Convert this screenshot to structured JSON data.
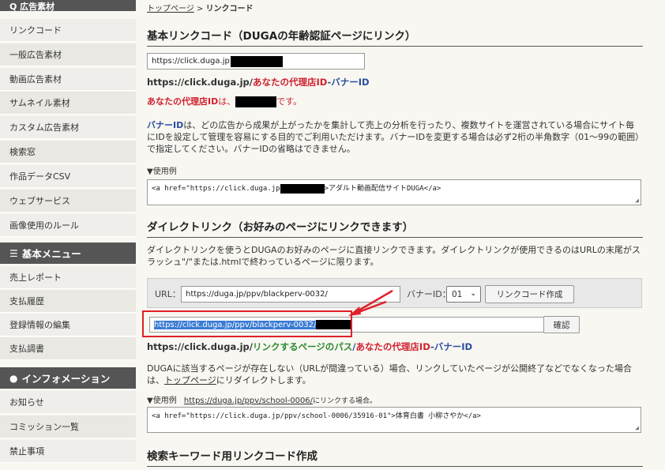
{
  "sidebar": {
    "top_heading": "Q 広告素材",
    "ad_items": [
      "リンクコード",
      "一般広告素材",
      "動画広告素材",
      "サムネイル素材",
      "カスタム広告素材",
      "検索窓",
      "作品データCSV",
      "ウェブサービス",
      "画像使用のルール"
    ],
    "basic_menu_heading": "基本メニュー",
    "basic_items": [
      "売上レポート",
      "支払履歴",
      "登録情報の編集",
      "支払調書"
    ],
    "info_heading": "インフォメーション",
    "info_items": [
      "お知らせ",
      "コミッション一覧",
      "禁止事項"
    ]
  },
  "breadcrumb": {
    "home": "トップページ",
    "sep": " > ",
    "current": "リンクコード"
  },
  "basic": {
    "heading": "基本リンクコード（DUGAの年齢認証ページにリンク）",
    "input_value": "https://click.duga.jp",
    "format_prefix": "https://click.duga.jp/",
    "format_agent": "あなたの代理店ID",
    "format_dash": "-",
    "format_banner": "バナーID",
    "agent_label": "あなたの代理店ID",
    "agent_mid": "は、",
    "agent_suffix": "です。",
    "banner_term": "バナーID",
    "banner_desc": "は、どの広告から成果が上がったかを集計して売上の分析を行ったり、複数サイトを運営されている場合にサイト毎にIDを設定して管理を容易にする目的でご利用いただけます。バナーIDを変更する場合は必ず2桁の半角数字（01〜99の範囲）で指定してください。バナーIDの省略はできません。",
    "example_label": "▼使用例",
    "example_code_a": "<a href=\"https://click.duga.jp",
    "example_code_b": ">アダルト動画配信サイトDUGA</a>"
  },
  "direct": {
    "heading": "ダイレクトリンク（お好みのページにリンクできます）",
    "desc": "ダイレクトリンクを使うとDUGAのお好みのページに直接リンクできます。ダイレクトリンクが使用できるのはURLの末尾がスラッシュ\"/\"または.htmlで終わっているページに限ります。",
    "url_label": "URL：",
    "url_value": "https://duga.jp/ppv/blackperv-0032/",
    "banner_label": "バナーID：",
    "banner_value": "01",
    "create_button": "リンクコード作成",
    "result_value": "https://click.duga.jp/ppv/blackperv-0032/",
    "confirm_button": "確認",
    "format_prefix": "https://click.duga.jp/",
    "format_path": "リンクするページのパス",
    "format_slash": "/",
    "format_agent": "あなたの代理店ID",
    "format_dash": "-",
    "format_banner": "バナーID",
    "note_a": "DUGAに該当するページが存在しない（URLが間違っている）場合、リンクしていたページが公開終了などでなくなった場合は、",
    "note_link": "トップページ",
    "note_b": "にリダイレクトします。",
    "example_label": "▼使用例",
    "example_url": "https://duga.jp/ppv/school-0006/",
    "example_suffix": "にリンクする場合。",
    "example_code": "<a href=\"https://click.duga.jp/ppv/school-0006/35916-01\">体育白書 小柳さやか</a>"
  },
  "search_section": {
    "heading": "検索キーワード用リンクコード作成"
  },
  "colors": {
    "accent_red": "#d0202d",
    "link_blue": "#2a4f9e",
    "annotation": "#e0202a"
  }
}
